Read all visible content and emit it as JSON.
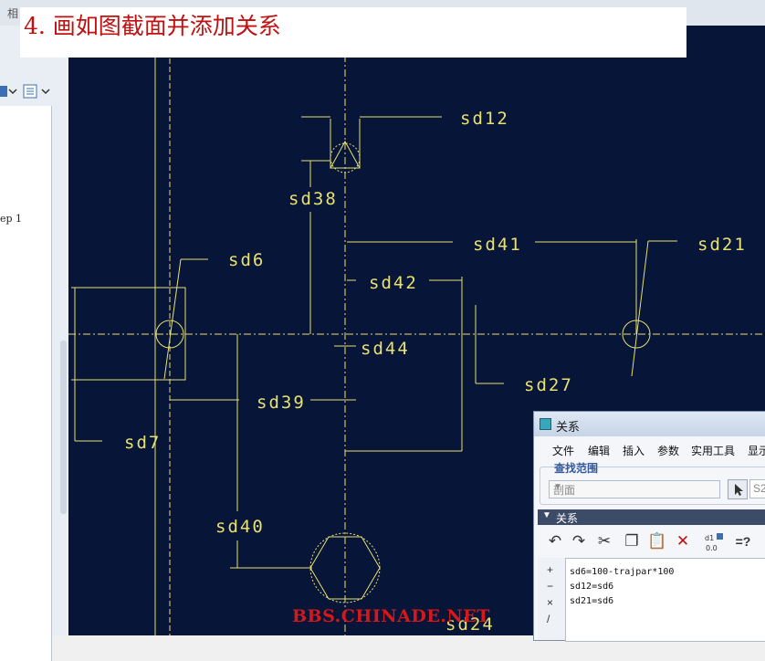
{
  "window": {
    "top_label": "相"
  },
  "title": "4. 画如图截面并添加关系",
  "left_panel": {
    "tree_text": "ep 1"
  },
  "sketch": {
    "dimension_labels": [
      "sd12",
      "sd38",
      "sd41",
      "sd21",
      "sd6",
      "sd42",
      "sd44",
      "sd27",
      "sd39",
      "sd7",
      "sd40",
      "sd24"
    ],
    "colors": {
      "background": "#061538",
      "lines": "#e8e070",
      "centerline": "#e8e070"
    }
  },
  "dialog": {
    "title": "关系",
    "menu": [
      "文件",
      "编辑",
      "插入",
      "参数",
      "实用工具",
      "显示"
    ],
    "scope_group_label": "查找范围",
    "scope_value": "剖面",
    "scope_field": "S2",
    "relations_header": "关系",
    "toolbar_icons": [
      "undo-icon",
      "redo-icon",
      "cut-icon",
      "copy-icon",
      "paste-icon",
      "delete-icon",
      "numeric-display-icon",
      "evaluate-icon"
    ],
    "evaluate_label": "=?",
    "side_buttons": [
      "+",
      "−",
      "×",
      "/"
    ],
    "relations": [
      "sd6=100-trajpar*100",
      "sd12=sd6",
      "sd21=sd6"
    ]
  },
  "watermark": "BBS.CHINADE.NET"
}
